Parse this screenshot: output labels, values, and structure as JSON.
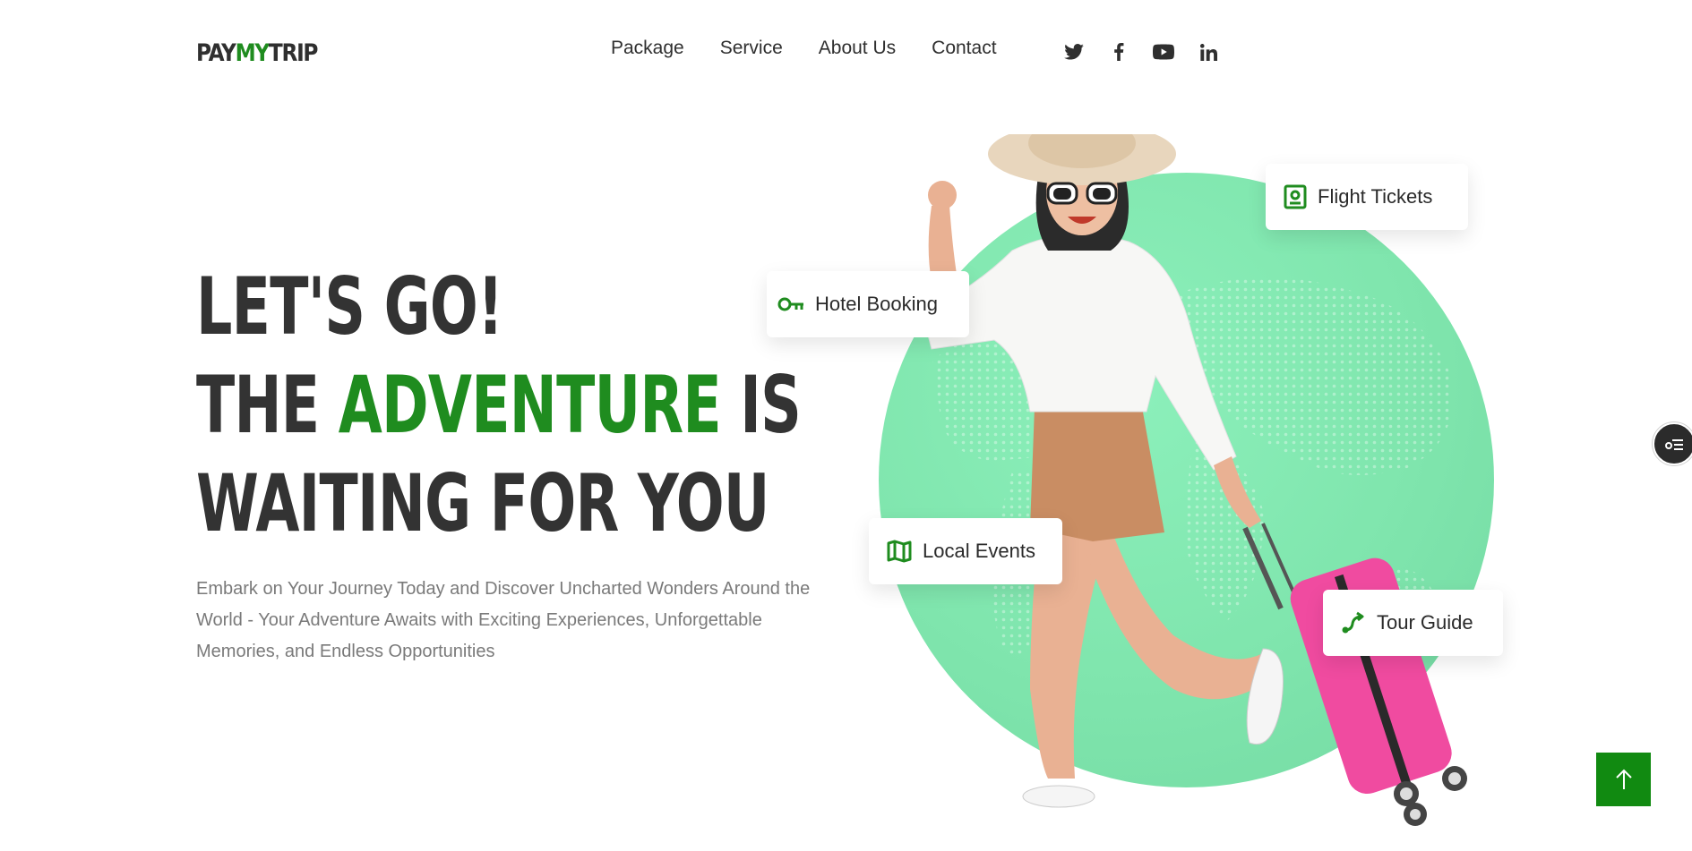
{
  "brand": {
    "part1": "PAY",
    "part2": "MY",
    "part3": "TRIP",
    "accent_color": "#1f8c1f"
  },
  "nav": {
    "items": [
      {
        "label": "Package"
      },
      {
        "label": "Service"
      },
      {
        "label": "About Us"
      },
      {
        "label": "Contact"
      }
    ]
  },
  "social": [
    "twitter-icon",
    "facebook-icon",
    "youtube-icon",
    "linkedin-icon"
  ],
  "hero": {
    "line1": "LET'S GO!",
    "line2_a": "THE ",
    "line2_b": "ADVENTURE",
    "line2_c": " IS",
    "line3": "WAITING FOR YOU",
    "description": "Embark on Your Journey Today and Discover Uncharted Wonders Around the World - Your Adventure Awaits with Exciting Experiences, Unforgettable Memories, and Endless Opportunities"
  },
  "features": [
    {
      "label": "Flight Tickets",
      "icon": "passport-icon"
    },
    {
      "label": "Hotel Booking",
      "icon": "key-icon"
    },
    {
      "label": "Local Events",
      "icon": "map-icon"
    },
    {
      "label": "Tour Guide",
      "icon": "route-icon"
    }
  ],
  "colors": {
    "globe": "#7fe5ad",
    "scroll_top": "#118a11",
    "text_dark": "#333333",
    "text_muted": "#7a7a7a"
  }
}
